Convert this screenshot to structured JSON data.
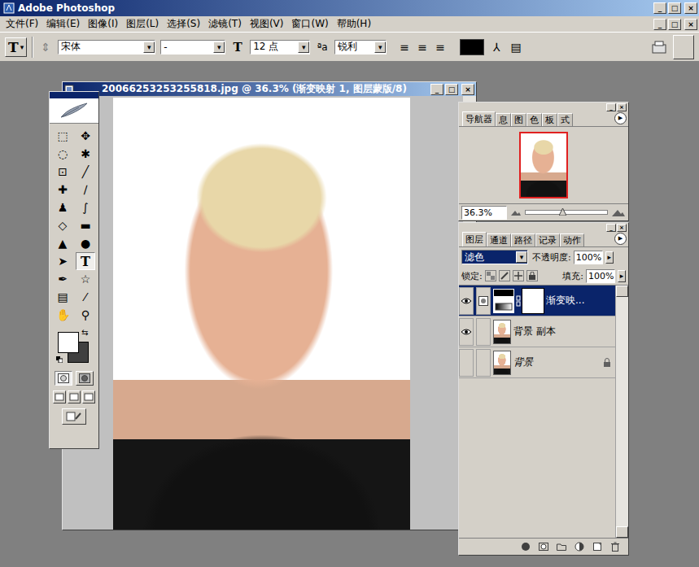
{
  "window": {
    "title": "Adobe Photoshop",
    "controls": [
      "_",
      "□",
      "×"
    ]
  },
  "menu": {
    "items": [
      "文件(F)",
      "编辑(E)",
      "图像(I)",
      "图层(L)",
      "选择(S)",
      "滤镜(T)",
      "视图(V)",
      "窗口(W)",
      "帮助(H)"
    ],
    "controls": [
      "_",
      "□",
      "×"
    ]
  },
  "options_bar": {
    "tool_glyph": "T",
    "dropdown_glyph": "▾",
    "orient_glyph": "⇕",
    "font_family": "宋体",
    "font_style": "-",
    "size_glyph": "T",
    "font_size": "12 点",
    "aa_glyph": "ªa",
    "antialias": "锐利",
    "align_glyphs": [
      "≡",
      "≡",
      "≡"
    ],
    "color": "#000000",
    "warp_glyph": "⅄",
    "palette_glyph": "▤"
  },
  "document": {
    "title": "20066253253255818.jpg @ 36.3% (渐变映射 1, 图层蒙版/8)",
    "controls": [
      "_",
      "□",
      "×"
    ],
    "scroll_down": "▼"
  },
  "toolbox": {
    "tools": [
      {
        "glyph": "⬚",
        "selected": false
      },
      {
        "glyph": "✥",
        "selected": false
      },
      {
        "glyph": "◌",
        "selected": false
      },
      {
        "glyph": "✱",
        "selected": false
      },
      {
        "glyph": "⊡",
        "selected": false
      },
      {
        "glyph": "╱",
        "selected": false
      },
      {
        "glyph": "✚",
        "selected": false
      },
      {
        "glyph": "∕",
        "selected": false
      },
      {
        "glyph": "♟",
        "selected": false
      },
      {
        "glyph": "∫",
        "selected": false
      },
      {
        "glyph": "◇",
        "selected": false
      },
      {
        "glyph": "▬",
        "selected": false
      },
      {
        "glyph": "▲",
        "selected": false
      },
      {
        "glyph": "●",
        "selected": false
      },
      {
        "glyph": "➤",
        "selected": false
      },
      {
        "glyph": "T",
        "selected": true
      },
      {
        "glyph": "✒",
        "selected": false
      },
      {
        "glyph": "☆",
        "selected": false
      },
      {
        "glyph": "▤",
        "selected": false
      },
      {
        "glyph": "⁄",
        "selected": false
      },
      {
        "glyph": "✋",
        "selected": false
      },
      {
        "glyph": "⚲",
        "selected": false
      }
    ],
    "foreground": "#ffffff",
    "background": "#404040",
    "swap_glyph": "⇆",
    "quick_mask": [
      {
        "selected": true
      },
      {
        "selected": false
      }
    ]
  },
  "navigator": {
    "controls": [
      "_",
      "×"
    ],
    "tabs": [
      {
        "label": "导航器",
        "selected": true
      },
      {
        "label": "息",
        "selected": false
      },
      {
        "label": "图",
        "selected": false
      },
      {
        "label": "色",
        "selected": false
      },
      {
        "label": "板",
        "selected": false
      },
      {
        "label": "式",
        "selected": false
      }
    ],
    "menu_glyph": "▶",
    "zoom": "36.3%",
    "zoom_level": 0.45
  },
  "layers": {
    "controls": [
      "_",
      "×"
    ],
    "tabs": [
      {
        "label": "图层",
        "selected": true
      },
      {
        "label": "通道",
        "selected": false
      },
      {
        "label": "路径",
        "selected": false
      },
      {
        "label": "记录",
        "selected": false
      },
      {
        "label": "动作",
        "selected": false
      }
    ],
    "menu_glyph": "▶",
    "blend_mode": "滤色",
    "opacity_label": "不透明度:",
    "opacity": "100%",
    "stepper_glyph": "▸",
    "lock_label": "锁定:",
    "fill_label": "填充:",
    "fill": "100%",
    "layers": [
      {
        "name": "渐变映...",
        "visible": true,
        "selected": true,
        "locked": false,
        "kind": "adjustment"
      },
      {
        "name": "背景 副本",
        "visible": true,
        "selected": false,
        "locked": false,
        "kind": "image"
      },
      {
        "name": "背景",
        "visible": false,
        "selected": false,
        "locked": true,
        "kind": "image"
      }
    ]
  }
}
